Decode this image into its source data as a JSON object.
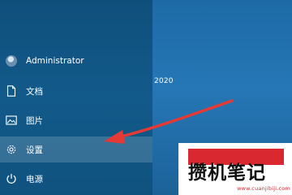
{
  "desktop": {
    "date_fragment": "2020"
  },
  "start_menu": {
    "user": {
      "label": "Administrator",
      "icon": "avatar"
    },
    "items": [
      {
        "label": "文档",
        "icon": "document-icon"
      },
      {
        "label": "图片",
        "icon": "picture-icon"
      },
      {
        "label": "设置",
        "icon": "gear-icon",
        "highlighted": true
      },
      {
        "label": "电源",
        "icon": "power-icon"
      }
    ]
  },
  "annotation": {
    "arrow_color": "#e53935",
    "points_to": "设置"
  },
  "watermark": {
    "text": "攒机笔记",
    "url": "www.cuanjibiji.com",
    "accent_color": "#d9282f"
  }
}
